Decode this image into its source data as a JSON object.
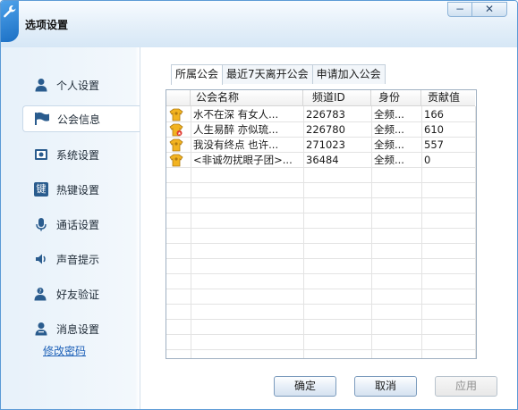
{
  "window": {
    "title": "选项设置",
    "minimize_glyph": "−",
    "close_glyph": "✕"
  },
  "sidebar": {
    "items": [
      {
        "label": "个人设置",
        "icon": "person-icon"
      },
      {
        "label": "公会信息",
        "icon": "flag-icon",
        "active": true
      },
      {
        "label": "系统设置",
        "icon": "system-icon"
      },
      {
        "label": "热键设置",
        "icon": "key-icon",
        "glyph": "键"
      },
      {
        "label": "通话设置",
        "icon": "microphone-icon"
      },
      {
        "label": "声音提示",
        "icon": "speaker-icon"
      },
      {
        "label": "好友验证",
        "icon": "friend-verify-icon"
      },
      {
        "label": "消息设置",
        "icon": "message-icon"
      }
    ],
    "change_password": "修改密码"
  },
  "tabs": [
    "所属公会",
    "最近7天离开公会",
    "申请加入公会"
  ],
  "table": {
    "columns": [
      "",
      "公会名称",
      "频道ID",
      "身份",
      "贡献值"
    ],
    "rows": [
      {
        "icon": "guild-member-icon",
        "name": "水不在深 有女人...",
        "channel_id": "226783",
        "role": "全频...",
        "contribution": "166"
      },
      {
        "icon": "guild-admin-icon",
        "name": "人生易醉 亦似琉...",
        "channel_id": "226780",
        "role": "全频...",
        "contribution": "610"
      },
      {
        "icon": "guild-member-icon",
        "name": "我没有终点 也许...",
        "channel_id": "271023",
        "role": "全频...",
        "contribution": "557"
      },
      {
        "icon": "guild-member-icon",
        "name": "<非诚勿扰眼子团>...",
        "channel_id": "36484",
        "role": "全频...",
        "contribution": "0"
      }
    ]
  },
  "buttons": {
    "ok": "确定",
    "cancel": "取消",
    "apply": "应用"
  },
  "colors": {
    "accent": "#1b6fc4",
    "link": "#1e61b8",
    "icon_blue": "#2a5c8e",
    "badge_gold": "#f2b320"
  }
}
